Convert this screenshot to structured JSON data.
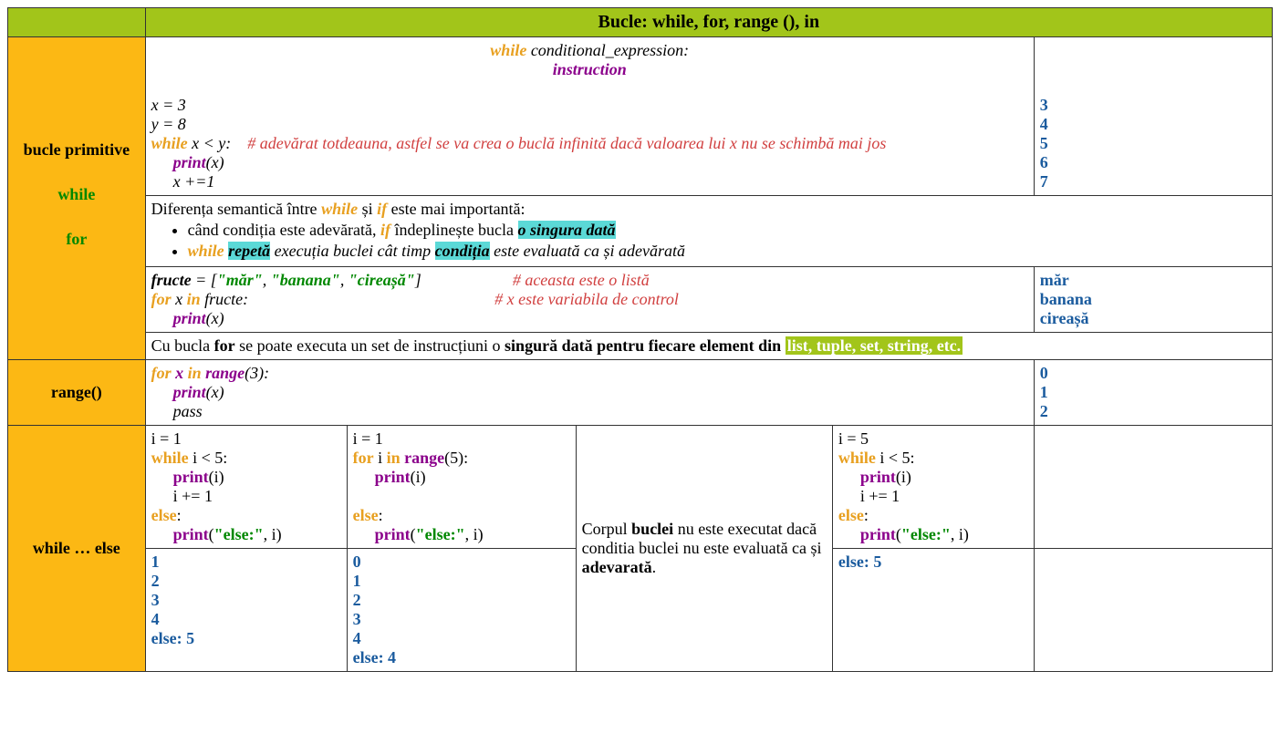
{
  "header": {
    "title": "Bucle: while, for, range (), in"
  },
  "labels": {
    "bucle_primitive": "bucle primitive",
    "while_kw": "while",
    "for_kw": "for",
    "range_kw": "range()",
    "while_else": "while … else"
  },
  "row1": {
    "syntax_while": "while",
    "syntax_cond": " conditional_expression:",
    "syntax_instr": "instruction",
    "code": {
      "l1": "x = 3",
      "l2": "y = 8",
      "l3_kw": "while",
      "l3_cond": " x < y:",
      "l3_comment": "# adevărat totdeauna, astfel se va crea o buclă infinită dacă valoarea lui x nu se schimbă mai jos",
      "l4_print": "print",
      "l4_arg": "(x)",
      "l5": "x +=1"
    },
    "output": [
      "3",
      "4",
      "5",
      "6",
      "7"
    ]
  },
  "row2": {
    "intro_a": "Diferența semantică între ",
    "intro_while": "while",
    "intro_b": " și ",
    "intro_if": "if",
    "intro_c": " este mai importantă:",
    "b1_a": "când condiția este adevărată, ",
    "b1_if": "if",
    "b1_b": " îndeplinește bucla ",
    "b1_hl": "o singura dată",
    "b2_kw": "while",
    "b2_sp": " ",
    "b2_hl1": "repetă",
    "b2_mid": " execuția buclei cât timp ",
    "b2_hl2": "condiția",
    "b2_end": " este evaluată ca și adevărată"
  },
  "row3": {
    "l1_var": "fructe",
    "l1_eq": " = [",
    "l1_s1": "\"măr\"",
    "l1_c": ", ",
    "l1_s2": "\"banana\"",
    "l1_s3": "\"cireașă\"",
    "l1_close": "]",
    "l1_comment": "# aceasta este o listă",
    "l2_for": "for",
    "l2_x": " x ",
    "l2_in": "in",
    "l2_rest": " fructe:",
    "l2_comment": "# x este variabila de control",
    "l3_print": "print",
    "l3_arg": "(x)",
    "output": [
      "măr",
      "banana",
      "cireașă"
    ]
  },
  "row4": {
    "a": "Cu bucla ",
    "for": "for",
    "b": " se poate executa un set de instrucțiuni o ",
    "c": "singură dată pentru fiecare element din ",
    "hl": "list, tuple, set, string, etc."
  },
  "row5": {
    "l1_for": "for",
    "l1_x": " x ",
    "l1_in": "in",
    "l1_sp": " ",
    "l1_range": "range",
    "l1_arg": "(3):",
    "l2_print": "print",
    "l2_arg": "(x)",
    "l3": "pass",
    "output": [
      "0",
      "1",
      "2"
    ]
  },
  "row6": {
    "colA": {
      "l1": "i = 1",
      "l2_kw": "while",
      "l2_rest": " i < 5:",
      "l3_print": "print",
      "l3_arg": "(i)",
      "l4": "i += 1",
      "l5_else": "else",
      "l5_colon": ":",
      "l6_print": "print",
      "l6_op": "(",
      "l6_str": "\"else:\"",
      "l6_rest": ", i)",
      "out": [
        "1",
        "2",
        "3",
        "4",
        "else: 5"
      ]
    },
    "colB": {
      "l1": "i = 1",
      "l2_for": "for",
      "l2_i": " i ",
      "l2_in": "in",
      "l2_sp": " ",
      "l2_range": "range",
      "l2_arg": "(5):",
      "l3_print": "print",
      "l3_arg": "(i)",
      "l5_else": "else",
      "l5_colon": ":",
      "l6_print": "print",
      "l6_op": "(",
      "l6_str": "\"else:\"",
      "l6_rest": ", i)",
      "out": [
        "0",
        "1",
        "2",
        "3",
        "4",
        "else: 4"
      ]
    },
    "colC": {
      "t1": "Corpul ",
      "t2": "buclei",
      "t3": " nu este executat dacă conditia buclei nu este evaluată ca și ",
      "t4": "adevarată",
      "t5": "."
    },
    "colD": {
      "l1": "i = 5",
      "l2_kw": "while",
      "l2_rest": " i < 5:",
      "l3_print": "print",
      "l3_arg": "(i)",
      "l4": "i += 1",
      "l5_else": "else",
      "l5_colon": ":",
      "l6_print": "print",
      "l6_op": "(",
      "l6_str": "\"else:\"",
      "l6_rest": ", i)",
      "out": "else: 5"
    }
  }
}
